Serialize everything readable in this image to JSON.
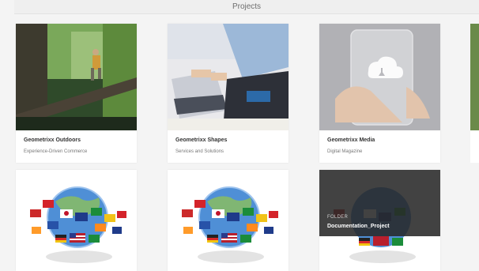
{
  "header": {
    "title": "Projects"
  },
  "cards": [
    {
      "title": "Geometrixx Outdoors",
      "subtitle": "Experience-Driven Commerce",
      "image": "hiker-on-log-image"
    },
    {
      "title": "Geometrixx Shapes",
      "subtitle": "Services and Solutions",
      "image": "laptop-typing-image"
    },
    {
      "title": "Geometrixx Media",
      "subtitle": "Digital Magazine",
      "image": "transparent-phone-image"
    }
  ],
  "folders": [
    {
      "image": "globe-flags-image"
    },
    {
      "image": "globe-flags-image"
    },
    {
      "kind": "FOLDER",
      "name": "Documentation_Project",
      "image": "globe-flags-image"
    }
  ],
  "colors": {
    "overlay": "#282828",
    "background": "#f4f4f4",
    "card": "#ffffff"
  }
}
